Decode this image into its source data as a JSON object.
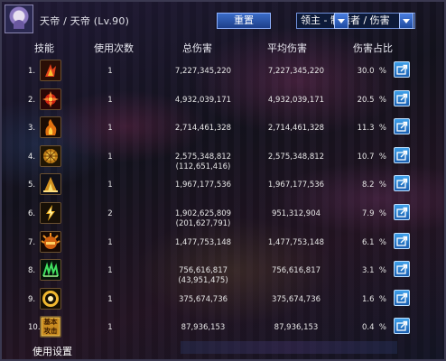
{
  "header": {
    "player_name": "天帝 / 天帝 (Lv.90)",
    "reset_label": "重置",
    "target_select": "领主 - 制造者 / 伤害"
  },
  "columns": {
    "skill": "技能",
    "count": "使用次数",
    "total_damage": "总伤害",
    "avg_damage": "平均伤害",
    "share": "伤害占比"
  },
  "rows": [
    {
      "idx": "1.",
      "icon": "fire-palm-skill-icon",
      "count": "1",
      "total": "7,227,345,220",
      "total2": "",
      "avg": "7,227,345,220",
      "pct": "30.0  %"
    },
    {
      "idx": "2.",
      "icon": "red-burst-skill-icon",
      "count": "1",
      "total": "4,932,039,171",
      "total2": "",
      "avg": "4,932,039,171",
      "pct": "20.5  %"
    },
    {
      "idx": "3.",
      "icon": "flame-hand-skill-icon",
      "count": "1",
      "total": "2,714,461,328",
      "total2": "",
      "avg": "2,714,461,328",
      "pct": "11.3  %"
    },
    {
      "idx": "4.",
      "icon": "golden-sun-skill-icon",
      "count": "1",
      "total": "2,575,348,812",
      "total2": "(112,651,416)",
      "avg": "2,575,348,812",
      "pct": "10.7  %"
    },
    {
      "idx": "5.",
      "icon": "shrine-skill-icon",
      "count": "1",
      "total": "1,967,177,536",
      "total2": "",
      "avg": "1,967,177,536",
      "pct": "8.2  %"
    },
    {
      "idx": "6.",
      "icon": "lightning-skill-icon",
      "count": "2",
      "total": "1,902,625,809",
      "total2": "(201,627,791)",
      "avg": "951,312,904",
      "pct": "7.9  %"
    },
    {
      "idx": "7.",
      "icon": "spiked-orb-skill-icon",
      "count": "1",
      "total": "1,477,753,148",
      "total2": "",
      "avg": "1,477,753,148",
      "pct": "6.1  %"
    },
    {
      "idx": "8.",
      "icon": "green-claw-skill-icon",
      "count": "1",
      "total": "756,616,817",
      "total2": "(43,951,475)",
      "avg": "756,616,817",
      "pct": "3.1  %"
    },
    {
      "idx": "9.",
      "icon": "gold-ring-skill-icon",
      "count": "1",
      "total": "375,674,736",
      "total2": "",
      "avg": "375,674,736",
      "pct": "1.6  %"
    },
    {
      "idx": "10.",
      "icon": "basic-attack-skill-icon",
      "icon_text": "基本攻击",
      "count": "1",
      "total": "87,936,153",
      "total2": "",
      "avg": "87,936,153",
      "pct": "0.4  %"
    }
  ],
  "footer": {
    "settings_label": "使用设置"
  },
  "colors": {
    "accent_button": "#2a58b4",
    "share_button": "#2d84d6",
    "text": "#e6e6e6"
  }
}
